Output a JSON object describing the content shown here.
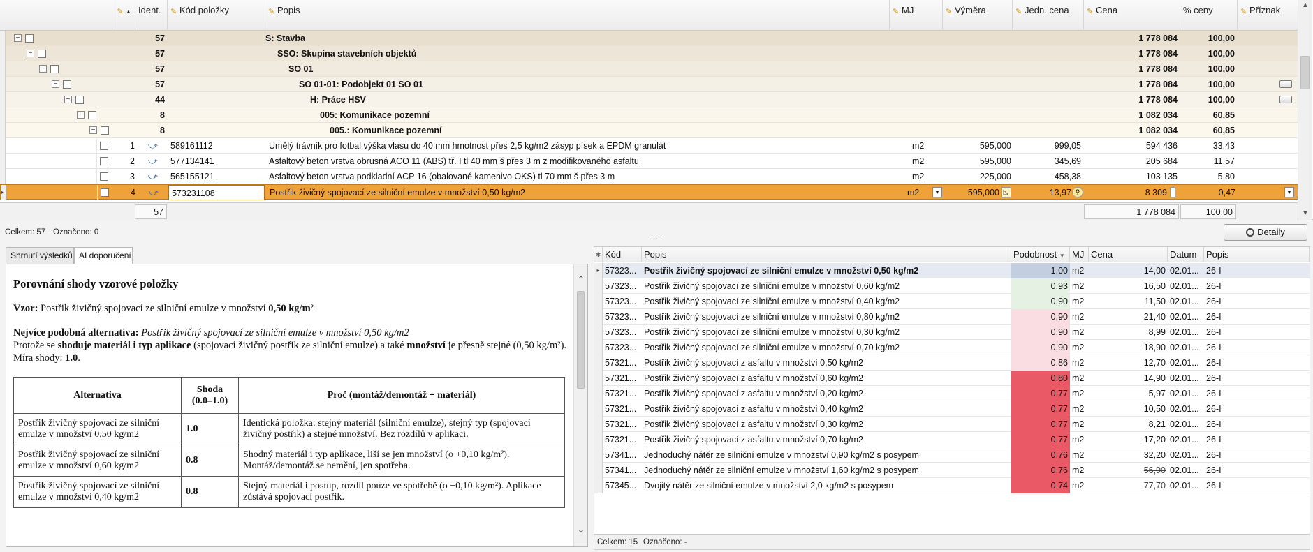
{
  "top_grid": {
    "headers": {
      "ident": "Ident.",
      "kod": "Kód položky",
      "popis": "Popis",
      "mj": "MJ",
      "vymera": "Výměra",
      "jedn_cena": "Jedn. cena",
      "cena": "Cena",
      "pct": "% ceny",
      "priznak": "Příznak"
    },
    "group_rows": [
      {
        "ident": "57",
        "popis": "S: Stavba",
        "cena": "1 778 084",
        "pct": "100,00",
        "flag": false
      },
      {
        "ident": "57",
        "popis": "SSO: Skupina stavebních objektů",
        "cena": "1 778 084",
        "pct": "100,00",
        "flag": false
      },
      {
        "ident": "57",
        "popis": "SO 01",
        "cena": "1 778 084",
        "pct": "100,00",
        "flag": false
      },
      {
        "ident": "57",
        "popis": "SO 01-01: Podobjekt 01 SO 01",
        "cena": "1 778 084",
        "pct": "100,00",
        "flag": true
      },
      {
        "ident": "44",
        "popis": "H: Práce HSV",
        "cena": "1 778 084",
        "pct": "100,00",
        "flag": true
      },
      {
        "ident": "8",
        "popis": "005: Komunikace pozemní",
        "cena": "1 082 034",
        "pct": "60,85",
        "flag": false
      },
      {
        "ident": "8",
        "popis": "005.: Komunikace pozemní",
        "cena": "1 082 034",
        "pct": "60,85",
        "flag": false
      }
    ],
    "item_rows": [
      {
        "num": "1",
        "kod": "589161112",
        "popis": "Umělý trávník pro fotbal výška vlasu do 40 mm hmotnost přes 2,5 kg/m2 zásyp písek a EPDM granulát",
        "mj": "m2",
        "vymera": "595,000",
        "jedn_cena": "999,05",
        "cena": "594 436",
        "pct": "33,43"
      },
      {
        "num": "2",
        "kod": "577134141",
        "popis": "Asfaltový beton vrstva obrusná ACO 11 (ABS) tř. I tl 40 mm š přes 3 m z modifikovaného asfaltu",
        "mj": "m2",
        "vymera": "595,000",
        "jedn_cena": "345,69",
        "cena": "205 684",
        "pct": "11,57"
      },
      {
        "num": "3",
        "kod": "565155121",
        "popis": "Asfaltový beton vrstva podkladní ACP 16 (obalované kamenivo OKS) tl 70 mm š přes 3 m",
        "mj": "m2",
        "vymera": "225,000",
        "jedn_cena": "458,38",
        "cena": "103 135",
        "pct": "5,80"
      },
      {
        "num": "4",
        "kod": "573231108",
        "popis": "Postřik živičný spojovací ze silniční emulze v množství 0,50 kg/m2",
        "mj": "m2",
        "vymera": "595,000",
        "jedn_cena": "13,97",
        "cena": "8 309",
        "pct": "0,47"
      }
    ],
    "footer": {
      "ident_total": "57",
      "cena_total": "1 778 084",
      "pct_total": "100,00"
    },
    "accent_selected": "#f0a23a"
  },
  "status_top": {
    "celkem": "Celkem: 57",
    "oznaceno": "Označeno: 0"
  },
  "detaily_button": "Detaily",
  "tabs": [
    {
      "label": "Shrnutí výsledků"
    },
    {
      "label": "AI doporučení"
    }
  ],
  "doc": {
    "heading": "Porovnání shody vzorové položky",
    "vzor_label": "Vzor:",
    "vzor_text": "Postřik živičný spojovací ze silniční emulze v množství",
    "vzor_amount": "0,50 kg/m²",
    "alt_label": "Nejvíce podobná alternativa:",
    "alt_text": "Postřik živičný spojovací ze silniční emulze v množství 0,50 kg/m2",
    "reason_1": "Protože se",
    "reason_b1": "shoduje materiál i typ aplikace",
    "reason_2": "(spojovací živičný postřik ze silniční emulze) a také",
    "reason_b2": "množství",
    "reason_3": "je přesně stejné (0,50 kg/m²).",
    "mira_label": "Míra shody:",
    "mira_value": "1.0",
    "table_headers": [
      "Alternativa",
      "Shoda (0.0–1.0)",
      "Proč (montáž/demontáž + materiál)"
    ],
    "table_rows": [
      {
        "alt": "Postřik živičný spojovací ze silniční emulze v množství 0,50 kg/m2",
        "shoda": "1.0",
        "proc": "Identická položka: stejný materiál (silniční emulze), stejný typ (spojovací živičný postřik) a stejné množství. Bez rozdílů v aplikaci."
      },
      {
        "alt": "Postřik živičný spojovací ze silniční emulze v množství 0,60 kg/m2",
        "shoda": "0.8",
        "proc": "Shodný materiál i typ aplikace, liší se jen množství (o +0,10 kg/m²). Montáž/demontáž se nemění, jen spotřeba."
      },
      {
        "alt": "Postřik živičný spojovací ze silniční emulze v množství 0,40 kg/m2",
        "shoda": "0.8",
        "proc": "Stejný materiál i postup, rozdíl pouze ve spotřebě (o −0,10 kg/m²). Aplikace zůstává spojovací postřik."
      }
    ]
  },
  "right_grid": {
    "headers": {
      "kod": "Kód",
      "popis": "Popis",
      "podobnost": "Podobnost",
      "mj": "MJ",
      "cena": "Cena",
      "datum": "Datum",
      "popis2": "Popis"
    },
    "rows": [
      {
        "kod": "57323...",
        "popis": "Postřik živičný spojovací ze silniční emulze v množství 0,50 kg/m2",
        "podobnost": "1,00",
        "mj": "m2",
        "cena": "14,00",
        "datum": "02.01...",
        "popis2": "26-I",
        "color": "#c3cfe0",
        "bold": true,
        "strike": false
      },
      {
        "kod": "57323...",
        "popis": "Postřik živičný spojovací ze silniční emulze v množství 0,60 kg/m2",
        "podobnost": "0,93",
        "mj": "m2",
        "cena": "16,50",
        "datum": "02.01...",
        "popis2": "26-I",
        "color": "#e4f1e3",
        "bold": false,
        "strike": false
      },
      {
        "kod": "57323...",
        "popis": "Postřik živičný spojovací ze silniční emulze v množství 0,40 kg/m2",
        "podobnost": "0,90",
        "mj": "m2",
        "cena": "11,50",
        "datum": "02.01...",
        "popis2": "26-I",
        "color": "#e4f1e3",
        "bold": false,
        "strike": false
      },
      {
        "kod": "57323...",
        "popis": "Postřik živičný spojovací ze silniční emulze v množství 0,80 kg/m2",
        "podobnost": "0,90",
        "mj": "m2",
        "cena": "21,40",
        "datum": "02.01...",
        "popis2": "26-I",
        "color": "#f9dde2",
        "bold": false,
        "strike": false
      },
      {
        "kod": "57323...",
        "popis": "Postřik živičný spojovací ze silniční emulze v množství 0,30 kg/m2",
        "podobnost": "0,90",
        "mj": "m2",
        "cena": "8,99",
        "datum": "02.01...",
        "popis2": "26-I",
        "color": "#f9dde2",
        "bold": false,
        "strike": false
      },
      {
        "kod": "57323...",
        "popis": "Postřik živičný spojovací ze silniční emulze v množství 0,70 kg/m2",
        "podobnost": "0,90",
        "mj": "m2",
        "cena": "18,90",
        "datum": "02.01...",
        "popis2": "26-I",
        "color": "#f9dde2",
        "bold": false,
        "strike": false
      },
      {
        "kod": "57321...",
        "popis": "Postřik živičný spojovací z asfaltu v množství 0,50 kg/m2",
        "podobnost": "0,86",
        "mj": "m2",
        "cena": "12,70",
        "datum": "02.01...",
        "popis2": "26-I",
        "color": "#f9dde2",
        "bold": false,
        "strike": false
      },
      {
        "kod": "57321...",
        "popis": "Postřik živičný spojovací z asfaltu v množství 0,60 kg/m2",
        "podobnost": "0,80",
        "mj": "m2",
        "cena": "14,90",
        "datum": "02.01...",
        "popis2": "26-I",
        "color": "#ea5a66",
        "bold": false,
        "strike": false
      },
      {
        "kod": "57321...",
        "popis": "Postřik živičný spojovací z asfaltu v množství 0,20 kg/m2",
        "podobnost": "0,77",
        "mj": "m2",
        "cena": "5,97",
        "datum": "02.01...",
        "popis2": "26-I",
        "color": "#ea5a66",
        "bold": false,
        "strike": false
      },
      {
        "kod": "57321...",
        "popis": "Postřik živičný spojovací z asfaltu v množství 0,40 kg/m2",
        "podobnost": "0,77",
        "mj": "m2",
        "cena": "10,50",
        "datum": "02.01...",
        "popis2": "26-I",
        "color": "#ea5a66",
        "bold": false,
        "strike": false
      },
      {
        "kod": "57321...",
        "popis": "Postřik živičný spojovací z asfaltu v množství 0,30 kg/m2",
        "podobnost": "0,77",
        "mj": "m2",
        "cena": "8,21",
        "datum": "02.01...",
        "popis2": "26-I",
        "color": "#ea5a66",
        "bold": false,
        "strike": false
      },
      {
        "kod": "57321...",
        "popis": "Postřik živičný spojovací z asfaltu v množství 0,70 kg/m2",
        "podobnost": "0,77",
        "mj": "m2",
        "cena": "17,20",
        "datum": "02.01...",
        "popis2": "26-I",
        "color": "#ea5a66",
        "bold": false,
        "strike": false
      },
      {
        "kod": "57341...",
        "popis": "Jednoduchý nátěr ze silniční emulze v množství 0,90 kg/m2 s posypem",
        "podobnost": "0,76",
        "mj": "m2",
        "cena": "32,20",
        "datum": "02.01...",
        "popis2": "26-I",
        "color": "#ea5a66",
        "bold": false,
        "strike": false
      },
      {
        "kod": "57341...",
        "popis": "Jednoduchý nátěr ze silniční emulze v množství 1,60 kg/m2 s posypem",
        "podobnost": "0,76",
        "mj": "m2",
        "cena": "56,90",
        "datum": "02.01...",
        "popis2": "26-I",
        "color": "#ea5a66",
        "bold": false,
        "strike": true
      },
      {
        "kod": "57345...",
        "popis": "Dvojitý nátěr ze silniční emulze v množství 2,0 kg/m2 s posypem",
        "podobnost": "0,74",
        "mj": "m2",
        "cena": "77,70",
        "datum": "02.01...",
        "popis2": "26-I",
        "color": "#ea5a66",
        "bold": false,
        "strike": true
      }
    ]
  },
  "status_bottom": {
    "celkem": "Celkem: 15",
    "oznaceno": "Označeno: -"
  }
}
